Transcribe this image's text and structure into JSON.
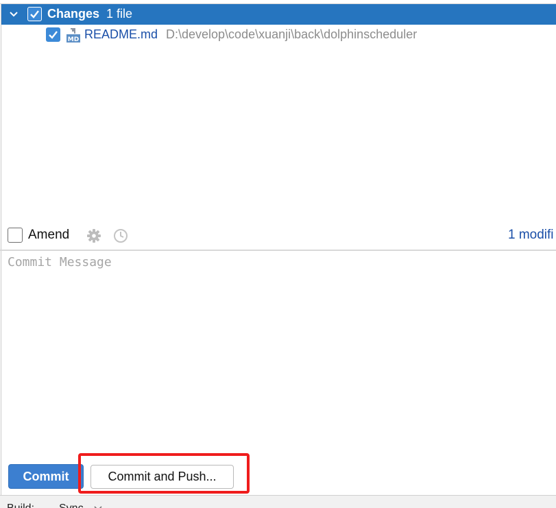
{
  "changes": {
    "group_title": "Changes",
    "group_count": "1 file",
    "files": [
      {
        "name": "README.md",
        "path": "D:\\develop\\code\\xuanji\\back\\dolphinscheduler",
        "icon_badge": "MD",
        "checked": true
      }
    ]
  },
  "options": {
    "amend_label": "Amend",
    "modified_summary": "1 modifi"
  },
  "message": {
    "placeholder": "Commit Message",
    "value": ""
  },
  "actions": {
    "commit_label": "Commit",
    "commit_push_label": "Commit and Push..."
  },
  "statusbar": {
    "build_label": "Build:",
    "sync_label": "Sync"
  },
  "colors": {
    "selection": "#2675bf",
    "checkbox": "#3c8ad8",
    "link_text": "#1a4fa8",
    "primary_button": "#3c7fd0",
    "highlight_box": "#ef1c1c"
  },
  "icons": [
    "chevron-down-icon",
    "checkbox-checked-icon",
    "markdown-file-icon",
    "gear-icon",
    "clock-icon"
  ]
}
